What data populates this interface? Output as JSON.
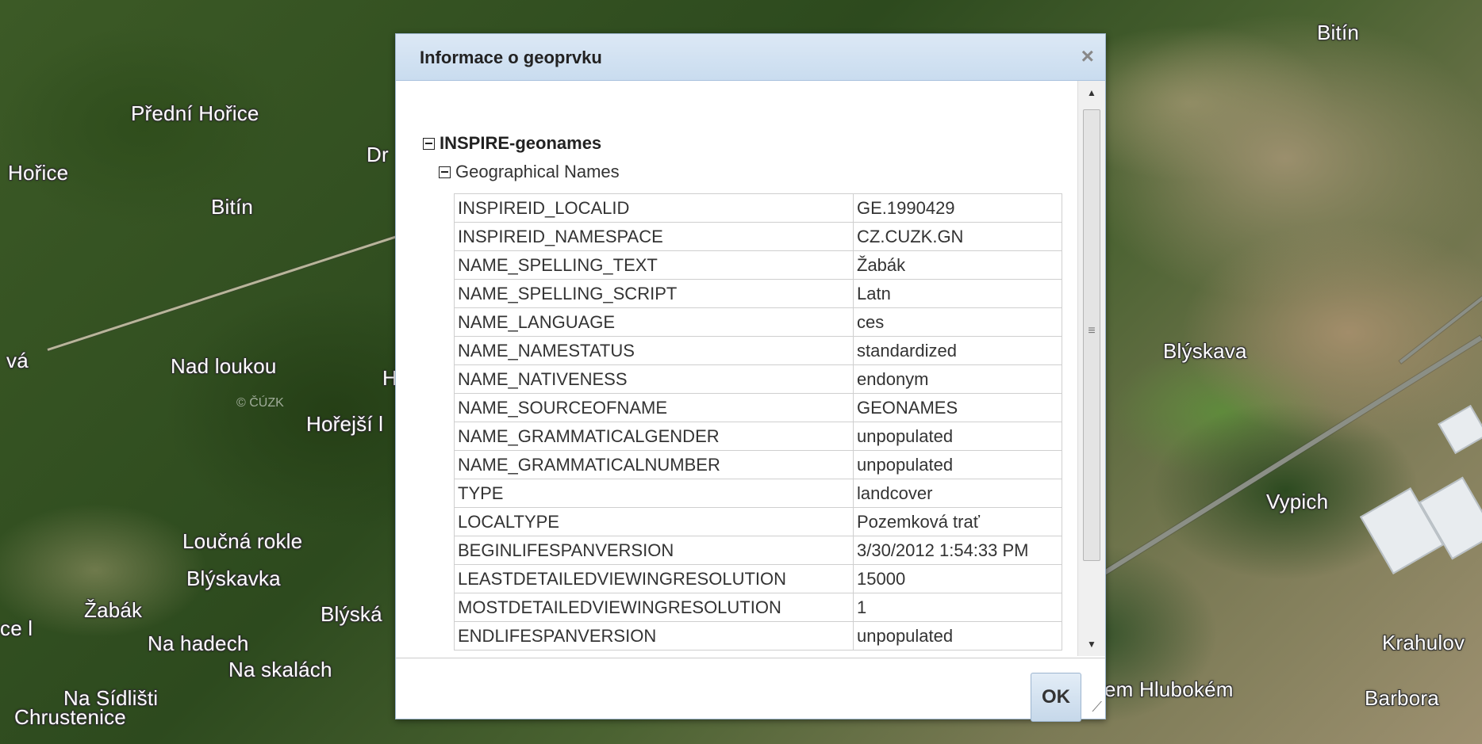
{
  "map": {
    "places": [
      {
        "name": "Přední Hořice"
      },
      {
        "name": "Hořice"
      },
      {
        "name": "Bitín"
      },
      {
        "name": "Dr"
      },
      {
        "name": "Nad loukou"
      },
      {
        "name": "vá"
      },
      {
        "name": "Hořejší l"
      },
      {
        "name": "H"
      },
      {
        "name": "Loučná rokle"
      },
      {
        "name": "Blýskavka"
      },
      {
        "name": "Žabák"
      },
      {
        "name": "Blýská"
      },
      {
        "name": "Na hadech"
      },
      {
        "name": "Na skalách"
      },
      {
        "name": "Na Sídlišti"
      },
      {
        "name": "Chrustenice"
      },
      {
        "name": "ce l"
      },
      {
        "name": "Bitín"
      },
      {
        "name": "Blýskava"
      },
      {
        "name": "Vypich"
      },
      {
        "name": "Krahulov"
      },
      {
        "name": "Barbora"
      },
      {
        "name": "em Hlubokém"
      }
    ],
    "copyright": "© ČÚZK"
  },
  "dialog": {
    "title": "Informace o geoprvku",
    "close_symbol": "×",
    "layer_name": "INSPIRE-geonames",
    "group_name": "Geographical Names",
    "attributes": [
      {
        "key": "INSPIREID_LOCALID",
        "value": "GE.1990429"
      },
      {
        "key": "INSPIREID_NAMESPACE",
        "value": "CZ.CUZK.GN"
      },
      {
        "key": "NAME_SPELLING_TEXT",
        "value": "Žabák"
      },
      {
        "key": "NAME_SPELLING_SCRIPT",
        "value": "Latn"
      },
      {
        "key": "NAME_LANGUAGE",
        "value": "ces"
      },
      {
        "key": "NAME_NAMESTATUS",
        "value": "standardized"
      },
      {
        "key": "NAME_NATIVENESS",
        "value": "endonym"
      },
      {
        "key": "NAME_SOURCEOFNAME",
        "value": "GEONAMES"
      },
      {
        "key": "NAME_GRAMMATICALGENDER",
        "value": "unpopulated"
      },
      {
        "key": "NAME_GRAMMATICALNUMBER",
        "value": "unpopulated"
      },
      {
        "key": "TYPE",
        "value": "landcover"
      },
      {
        "key": "LOCALTYPE",
        "value": "Pozemková trať"
      },
      {
        "key": "BEGINLIFESPANVERSION",
        "value": "3/30/2012 1:54:33 PM"
      },
      {
        "key": "LEASTDETAILEDVIEWINGRESOLUTION",
        "value": "15000"
      },
      {
        "key": "MOSTDETAILEDVIEWINGRESOLUTION",
        "value": "1"
      },
      {
        "key": "ENDLIFESPANVERSION",
        "value": "unpopulated"
      }
    ],
    "ok_label": "OK",
    "scrollbar_grip": "≡"
  }
}
